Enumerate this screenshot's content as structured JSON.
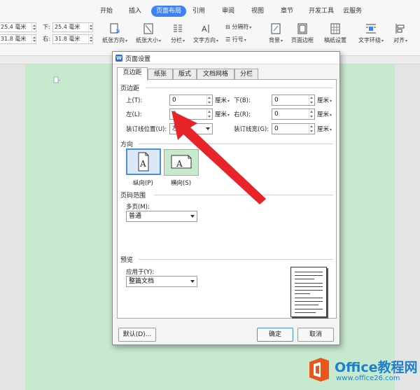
{
  "ribbon": {
    "tabs": [
      "开始",
      "插入",
      "页面布局",
      "引用",
      "审阅",
      "视图",
      "章节",
      "开发工具",
      "云服务"
    ],
    "active_tab": "页面布局",
    "margins": {
      "top_value": "25.4 毫米",
      "bottom_label": "下:",
      "bottom_value": "25.4 毫米",
      "left_value": "31.8 毫米",
      "right_label": "右:",
      "right_value": "31.8 毫米"
    },
    "tools": {
      "orientation": "纸张方向",
      "size": "纸张大小",
      "columns": "分栏",
      "text_direction": "文字方向",
      "breaks": "分隔符",
      "line_numbers": "行号",
      "background": "背景",
      "page_border": "页面边框",
      "draft": "稿纸设置",
      "wrap": "文字环绕",
      "align": "对齐"
    }
  },
  "dialog": {
    "title": "页面设置",
    "tabs": [
      "页边距",
      "纸张",
      "版式",
      "文档网格",
      "分栏"
    ],
    "active_tab": "页边距",
    "margins_section": "页边距",
    "top_label": "上(T):",
    "top_value": "0",
    "bottom_label": "下(B):",
    "bottom_value": "0",
    "left_label": "左(L):",
    "left_value": "0",
    "right_label": "右(R):",
    "right_value": "0",
    "unit": "厘米",
    "gutter_pos_label": "装订线位置(U):",
    "gutter_pos_value": "左",
    "gutter_label": "装订线宽(G):",
    "gutter_value": "0",
    "orientation_section": "方向",
    "portrait_label": "纵向(P)",
    "landscape_label": "横向(S)",
    "range_section": "页码范围",
    "pages_label": "多页(M):",
    "pages_value": "普通",
    "preview_section": "预览",
    "apply_label": "应用于(Y):",
    "apply_value": "整篇文档",
    "default_button": "默认(D)...",
    "ok_button": "确定",
    "cancel_button": "取消"
  },
  "watermark": {
    "title": "Office教程网",
    "url": "www.office26.com"
  },
  "colors": {
    "accent": "#3b82f6",
    "page_green": "#c7e9cd",
    "arrow_red": "#e8232a",
    "brand_orange": "#e8561e",
    "brand_blue": "#1e7fd0"
  }
}
